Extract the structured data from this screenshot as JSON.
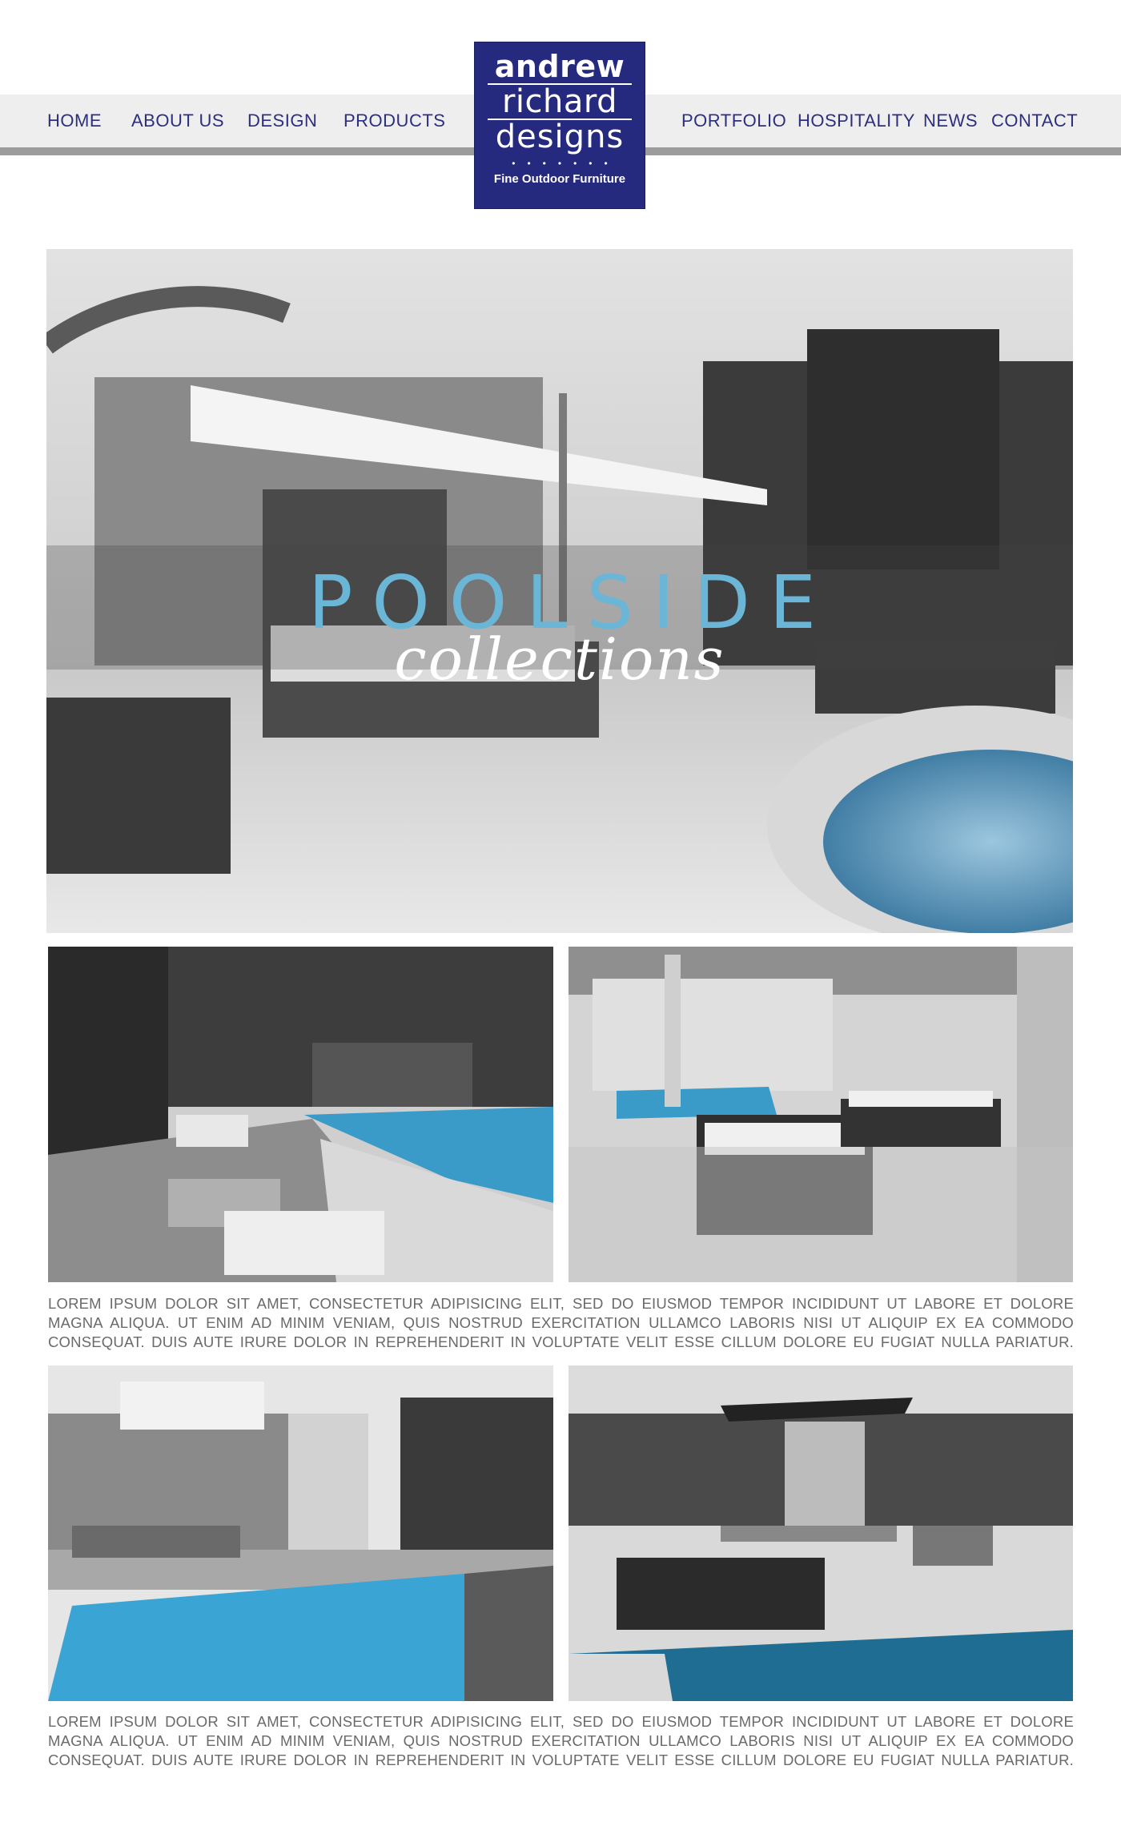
{
  "nav": {
    "left": [
      "HOME",
      "ABOUT US",
      "DESIGN",
      "PRODUCTS"
    ],
    "right": [
      "PORTFOLIO",
      "HOSPITALITY",
      "NEWS",
      "CONTACT"
    ]
  },
  "logo": {
    "line1": "andrew",
    "line2": "richard",
    "line3": "designs",
    "dots": "•••••••",
    "tagline": "Fine Outdoor Furniture"
  },
  "hero": {
    "title": "POOLSIDE",
    "subtitle": "collections"
  },
  "body": {
    "paragraph1": "Lorem ipsum dolor sit amet, consectetur adipisicing elit, sed do eiusmod tempor incididunt ut labore et dolore magna aliqua. Ut enim ad minim veniam, quis nostrud exercitation ullamco laboris nisi ut aliquip ex ea commodo consequat. Duis aute irure dolor in reprehenderit in voluptate velit esse cillum dolore eu fugiat nulla pariatur.",
    "paragraph2": "Lorem ipsum dolor sit amet, consectetur adipisicing elit, sed do eiusmod tempor incididunt ut labore et dolore magna aliqua. Ut enim ad minim veniam, quis nostrud exercitation ullamco laboris nisi ut aliquip ex ea commodo consequat. Duis aute irure dolor in reprehenderit in voluptate velit esse cillum dolore eu fugiat nulla pariatur."
  },
  "colors": {
    "brand": "#262a7e",
    "nav_text": "#2d2f7e",
    "nav_band": "#eeeeee",
    "nav_rule": "#9c9c9c",
    "hero_title": "#6bb6d6",
    "pool_blue": "#3a9bc8"
  }
}
